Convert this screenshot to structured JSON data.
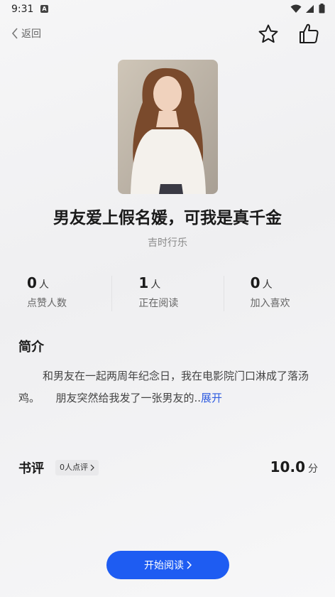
{
  "status_bar": {
    "time": "9:31",
    "notification_badge": "A"
  },
  "nav": {
    "back_label": "返回"
  },
  "book": {
    "title": "男友爱上假名媛，可我是真千金",
    "author": "吉时行乐"
  },
  "stats": [
    {
      "value": "0",
      "unit": "人",
      "label": "点赞人数"
    },
    {
      "value": "1",
      "unit": "人",
      "label": "正在阅读"
    },
    {
      "value": "0",
      "unit": "人",
      "label": "加入喜欢"
    }
  ],
  "intro": {
    "heading": "简介",
    "text": "和男友在一起两周年纪念日，我在电影院门口淋成了落汤鸡。　　朋友突然给我发了一张男友的..",
    "expand_label": "展开"
  },
  "review": {
    "heading": "书评",
    "chip_label": "0人点评",
    "score": "10.0",
    "score_unit": "分"
  },
  "actions": {
    "start_reading_label": "开始阅读"
  },
  "colors": {
    "accent": "#1e5cf2",
    "link": "#2f5ce0"
  }
}
